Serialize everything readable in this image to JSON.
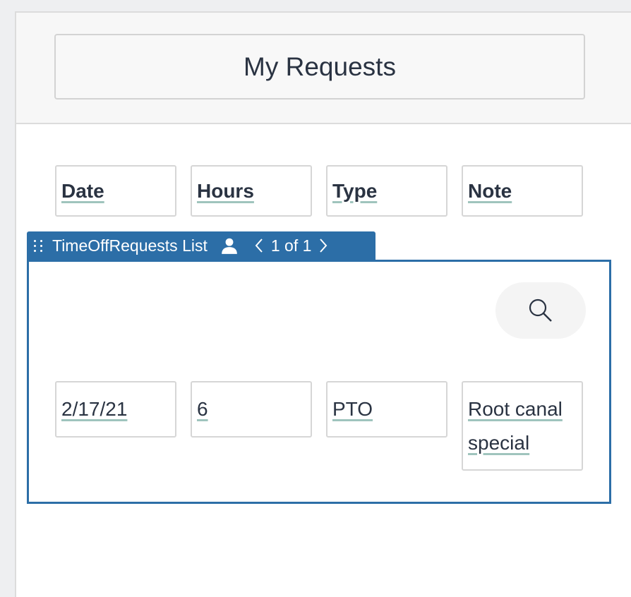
{
  "page": {
    "title": "My Requests"
  },
  "table": {
    "headers": [
      "Date",
      "Hours",
      "Type",
      "Note"
    ],
    "rows": [
      {
        "date": "2/17/21",
        "hours": "6",
        "type": "PTO",
        "note": "Root canal special"
      }
    ]
  },
  "list": {
    "label": "TimeOffRequests List",
    "pager": "1 of 1",
    "user_icon": "user-icon",
    "search_icon": "search-icon"
  },
  "colors": {
    "accent": "#2c6ea7",
    "underline": "#9fc4bd",
    "text": "#2a3342"
  }
}
